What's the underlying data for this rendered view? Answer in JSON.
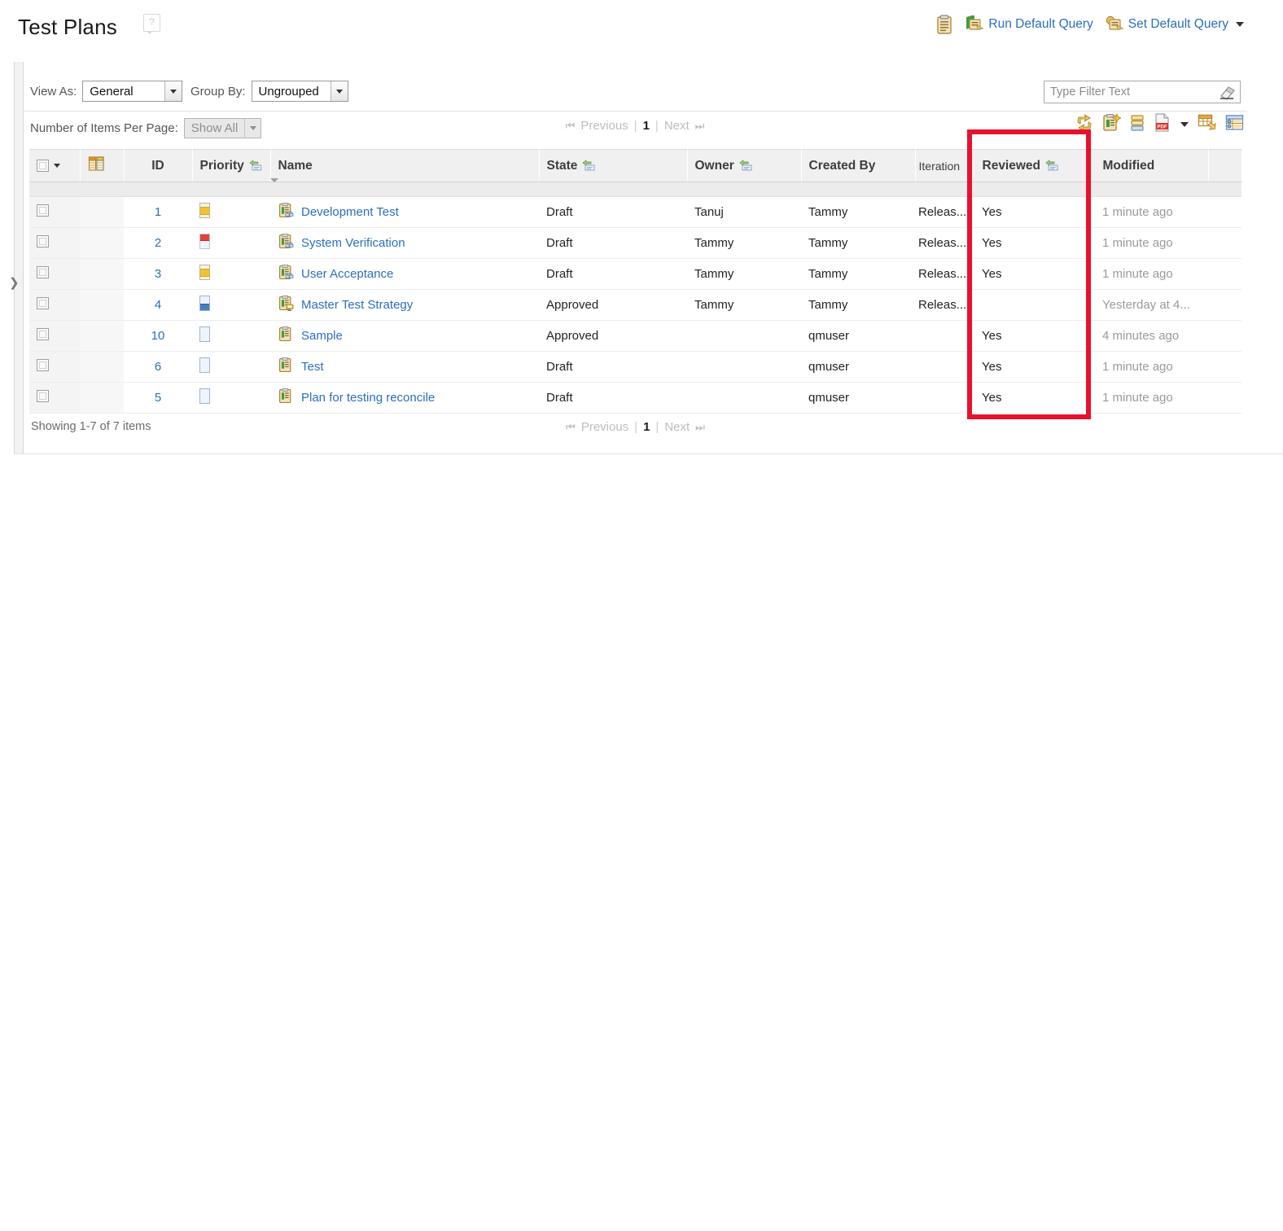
{
  "header": {
    "title": "Test Plans",
    "help_icon": "help-icon",
    "actions": [
      {
        "label": "",
        "icon": "clipboard-icon",
        "name": "clipboard-button"
      },
      {
        "label": "Run Default Query",
        "icon": "run-query-icon",
        "name": "run-default-query-button"
      },
      {
        "label": "Set Default Query",
        "icon": "set-query-icon",
        "name": "set-default-query-button",
        "has_caret": true
      }
    ]
  },
  "toolbar": {
    "view_as_label": "View As:",
    "view_as_value": "General",
    "group_by_label": "Group By:",
    "group_by_value": "Ungrouped",
    "filter_placeholder": "Type Filter Text",
    "filter_value": "",
    "filter_clear_icon": "eraser-icon",
    "items_per_page_label": "Number of Items Per Page:",
    "items_per_page_value": "Show All",
    "icons": [
      {
        "name": "refresh-icon",
        "title": "Refresh"
      },
      {
        "name": "new-test-plan-icon",
        "title": "New Test Plan"
      },
      {
        "name": "columns-icon",
        "title": "Columns"
      },
      {
        "name": "export-pdf-icon",
        "title": "Export PDF"
      },
      {
        "name": "export-dropdown-caret",
        "title": "Export options"
      },
      {
        "name": "export-table-icon",
        "title": "Export Table"
      },
      {
        "name": "configure-table-icon",
        "title": "Configure Table"
      }
    ]
  },
  "pager": {
    "previous": "Previous",
    "page": "1",
    "next": "Next",
    "first_icon": "first-page-icon",
    "last_icon": "last-page-icon",
    "separator": "|"
  },
  "table": {
    "columns": [
      {
        "key": "checkbox",
        "label": "",
        "icon": "select-all-checkbox"
      },
      {
        "key": "type",
        "label": "",
        "icon": "column-chooser-icon"
      },
      {
        "key": "id",
        "label": "ID"
      },
      {
        "key": "priority",
        "label": "Priority",
        "sort_icon": "filter-sort-icon"
      },
      {
        "key": "name",
        "label": "Name"
      },
      {
        "key": "state",
        "label": "State",
        "sort_icon": "filter-sort-icon"
      },
      {
        "key": "owner",
        "label": "Owner",
        "sort_icon": "filter-sort-icon"
      },
      {
        "key": "created_by",
        "label": "Created By"
      },
      {
        "key": "iteration",
        "label": "Iteration"
      },
      {
        "key": "reviewed",
        "label": "Reviewed",
        "sort_icon": "filter-sort-icon"
      },
      {
        "key": "modified",
        "label": "Modified"
      },
      {
        "key": "tail",
        "label": ""
      }
    ],
    "rows": [
      {
        "id": "1",
        "priority": "medium",
        "priority_icon": "priority-medium-icon",
        "name": "Development Test",
        "name_icon": "test-plan-shared-icon",
        "state": "Draft",
        "owner": "Tanuj",
        "created_by": "Tammy",
        "iteration": "Releas...",
        "reviewed": "Yes",
        "modified": "1 minute ago"
      },
      {
        "id": "2",
        "priority": "high",
        "priority_icon": "priority-high-icon",
        "name": "System Verification",
        "name_icon": "test-plan-shared-icon",
        "state": "Draft",
        "owner": "Tammy",
        "created_by": "Tammy",
        "iteration": "Releas...",
        "reviewed": "Yes",
        "modified": "1 minute ago"
      },
      {
        "id": "3",
        "priority": "medium",
        "priority_icon": "priority-medium-icon",
        "name": "User Acceptance",
        "name_icon": "test-plan-shared-icon",
        "state": "Draft",
        "owner": "Tammy",
        "created_by": "Tammy",
        "iteration": "Releas...",
        "reviewed": "Yes",
        "modified": "1 minute ago"
      },
      {
        "id": "4",
        "priority": "low",
        "priority_icon": "priority-low-icon",
        "name": "Master Test Strategy",
        "name_icon": "test-plan-master-icon",
        "state": "Approved",
        "owner": "Tammy",
        "created_by": "Tammy",
        "iteration": "Releas...",
        "reviewed": "",
        "modified": "Yesterday at 4..."
      },
      {
        "id": "10",
        "priority": "none",
        "priority_icon": "priority-unassigned-icon",
        "name": "Sample",
        "name_icon": "test-plan-icon",
        "state": "Approved",
        "owner": "",
        "created_by": "qmuser",
        "iteration": "",
        "reviewed": "Yes",
        "modified": "4 minutes ago"
      },
      {
        "id": "6",
        "priority": "none",
        "priority_icon": "priority-unassigned-icon",
        "name": "Test",
        "name_icon": "test-plan-icon",
        "state": "Draft",
        "owner": "",
        "created_by": "qmuser",
        "iteration": "",
        "reviewed": "Yes",
        "modified": "1 minute ago"
      },
      {
        "id": "5",
        "priority": "none",
        "priority_icon": "priority-unassigned-icon",
        "name": "Plan for testing reconcile",
        "name_icon": "test-plan-icon",
        "state": "Draft",
        "owner": "",
        "created_by": "qmuser",
        "iteration": "",
        "reviewed": "Yes",
        "modified": "1 minute ago"
      }
    ]
  },
  "footer": {
    "showing": "Showing 1-7 of 7 items"
  },
  "sidebar": {
    "expand_icon": "expand-panel-arrow"
  },
  "annotation": {
    "highlight_color": "#e8112d",
    "highlight_target": "Reviewed column"
  },
  "colors": {
    "link": "#2a6fbb",
    "header_bg": "#f0f0f0",
    "muted_text": "#9a9a9a",
    "highlight": "#e8112d"
  }
}
